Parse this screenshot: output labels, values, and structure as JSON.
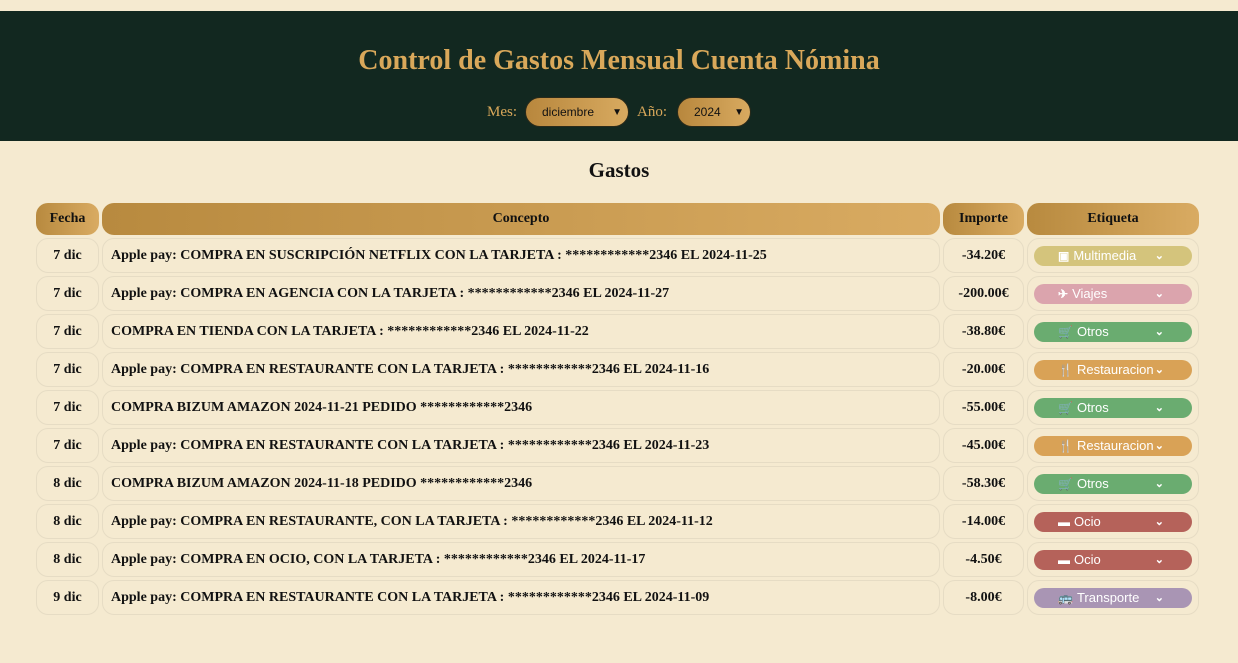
{
  "header": {
    "title": "Control de Gastos Mensual Cuenta Nómina",
    "mes_label": "Mes:",
    "mes_value": "diciembre",
    "anio_label": "Año:",
    "anio_value": "2024"
  },
  "section_title": "Gastos",
  "table": {
    "columns": [
      "Fecha",
      "Concepto",
      "Importe",
      "Etiqueta"
    ],
    "rows": [
      {
        "fecha": "7 dic",
        "concepto": "Apple pay: COMPRA EN SUSCRIPCIÓN NETFLIX CON LA TARJETA : ************2346 EL 2024-11-25",
        "importe": "-34.20€",
        "etiqueta": "Multimedia",
        "icon": "multimedia-icon",
        "glyph": "▣",
        "color": "#d4c47c"
      },
      {
        "fecha": "7 dic",
        "concepto": "Apple pay: COMPRA EN AGENCIA CON LA TARJETA : ************2346 EL 2024-11-27",
        "importe": "-200.00€",
        "etiqueta": "Viajes",
        "icon": "plane-icon",
        "glyph": "✈",
        "color": "#dba4ad"
      },
      {
        "fecha": "7 dic",
        "concepto": "COMPRA EN TIENDA CON LA TARJETA : ************2346 EL 2024-11-22",
        "importe": "-38.80€",
        "etiqueta": "Otros",
        "icon": "cart-icon",
        "glyph": "🛒",
        "color": "#6aac70"
      },
      {
        "fecha": "7 dic",
        "concepto": "Apple pay: COMPRA EN RESTAURANTE CON LA TARJETA : ************2346 EL 2024-11-16",
        "importe": "-20.00€",
        "etiqueta": "Restauracion",
        "icon": "utensils-icon",
        "glyph": "🍴",
        "color": "#d9a256"
      },
      {
        "fecha": "7 dic",
        "concepto": "COMPRA BIZUM AMAZON 2024-11-21 PEDIDO ************2346",
        "importe": "-55.00€",
        "etiqueta": "Otros",
        "icon": "cart-icon",
        "glyph": "🛒",
        "color": "#6aac70"
      },
      {
        "fecha": "7 dic",
        "concepto": "Apple pay: COMPRA EN RESTAURANTE CON LA TARJETA : ************2346 EL 2024-11-23",
        "importe": "-45.00€",
        "etiqueta": "Restauracion",
        "icon": "utensils-icon",
        "glyph": "🍴",
        "color": "#d9a256"
      },
      {
        "fecha": "8 dic",
        "concepto": "COMPRA BIZUM AMAZON 2024-11-18 PEDIDO ************2346",
        "importe": "-58.30€",
        "etiqueta": "Otros",
        "icon": "cart-icon",
        "glyph": "🛒",
        "color": "#6aac70"
      },
      {
        "fecha": "8 dic",
        "concepto": "Apple pay: COMPRA EN RESTAURANTE, CON LA TARJETA : ************2346 EL 2024-11-12",
        "importe": "-14.00€",
        "etiqueta": "Ocio",
        "icon": "ticket-icon",
        "glyph": "▬",
        "color": "#b5625a"
      },
      {
        "fecha": "8 dic",
        "concepto": "Apple pay: COMPRA EN OCIO, CON LA TARJETA : ************2346 EL 2024-11-17",
        "importe": "-4.50€",
        "etiqueta": "Ocio",
        "icon": "ticket-icon",
        "glyph": "▬",
        "color": "#b5625a"
      },
      {
        "fecha": "9 dic",
        "concepto": "Apple pay: COMPRA EN RESTAURANTE CON LA TARJETA : ************2346 EL 2024-11-09",
        "importe": "-8.00€",
        "etiqueta": "Transporte",
        "icon": "bus-icon",
        "glyph": "🚌",
        "color": "#a995b4"
      }
    ]
  }
}
